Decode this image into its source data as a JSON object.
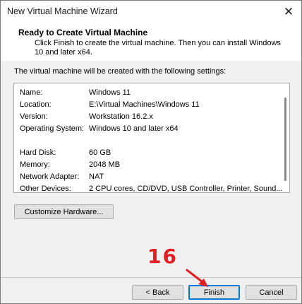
{
  "window": {
    "title": "New Virtual Machine Wizard",
    "close_glyph": "✕"
  },
  "header": {
    "title": "Ready to Create Virtual Machine",
    "description": "Click Finish to create the virtual machine. Then you can install Windows 10 and later x64."
  },
  "intro_text": "The virtual machine will be created with the following settings:",
  "settings": [
    {
      "label": "Name:",
      "value": "Windows 11"
    },
    {
      "label": "Location:",
      "value": "E:\\Virtual Machines\\Windows 11"
    },
    {
      "label": "Version:",
      "value": "Workstation 16.2.x"
    },
    {
      "label": "Operating System:",
      "value": "Windows 10 and later x64"
    },
    {
      "label": "Hard Disk:",
      "value": "60 GB"
    },
    {
      "label": "Memory:",
      "value": "2048 MB"
    },
    {
      "label": "Network Adapter:",
      "value": "NAT"
    },
    {
      "label": "Other Devices:",
      "value": "2 CPU cores, CD/DVD, USB Controller, Printer, Sound..."
    }
  ],
  "buttons": {
    "customize": "Customize Hardware...",
    "back": "< Back",
    "finish": "Finish",
    "cancel": "Cancel"
  },
  "annotation": {
    "step_number": "16",
    "color": "#e31e24"
  }
}
